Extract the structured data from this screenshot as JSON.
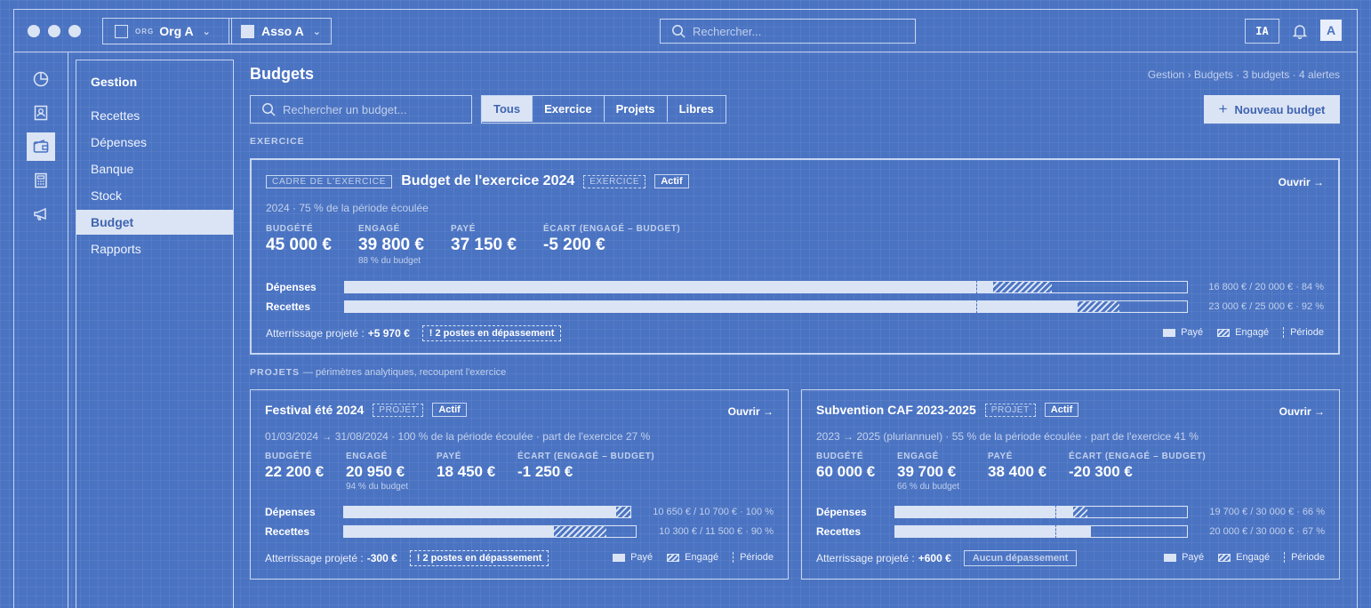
{
  "topbar": {
    "org_tag": "ORG",
    "org_name": "Org A",
    "asso_name": "Asso A",
    "search_placeholder": "Rechercher...",
    "ia_label": "IA",
    "avatar_initial": "A"
  },
  "rail": {
    "icons": [
      "pie-chart-icon",
      "contact-card-icon",
      "wallet-icon",
      "calculator-icon",
      "megaphone-icon"
    ],
    "active": "wallet-icon"
  },
  "sidenav": {
    "title": "Gestion",
    "items": [
      "Recettes",
      "Dépenses",
      "Banque",
      "Stock",
      "Budget",
      "Rapports"
    ],
    "active": "Budget"
  },
  "main": {
    "title": "Budgets",
    "breadcrumb": "Gestion › Budgets · 3 budgets · 4 alertes",
    "search_placeholder": "Rechercher un budget...",
    "filters": [
      "Tous",
      "Exercice",
      "Projets",
      "Libres"
    ],
    "active_filter": "Tous",
    "new_button": "Nouveau budget",
    "section_exercice": "EXERCICE",
    "section_projets": "PROJETS",
    "section_projets_sub": "— périmètres analytiques, recoupent l'exercice"
  },
  "legend": {
    "paid": "Payé",
    "engaged": "Engagé",
    "period": "Période"
  },
  "budgets": [
    {
      "frame_tag": "CADRE DE L'EXERCICE",
      "title": "Budget de l'exercice 2024",
      "type_tag": "EXERCICE",
      "status": "Actif",
      "open": "Ouvrir →",
      "subtitle": "2024 · 75 % de la période écoulée",
      "metrics": [
        {
          "label": "BUDGÉTÉ",
          "value": "45 000 €",
          "note": ""
        },
        {
          "label": "ENGAGÉ",
          "value": "39 800 €",
          "note": "88 % du budget"
        },
        {
          "label": "PAYÉ",
          "value": "37 150 €",
          "note": ""
        },
        {
          "label": "ÉCART (ENGAGÉ – BUDGET)",
          "value": "-5 200 €",
          "note": ""
        }
      ],
      "bars": [
        {
          "label": "Dépenses",
          "paid": 0.77,
          "engaged": 0.84,
          "period": 0.75,
          "stat": "16 800 € / 20 000 € · 84 %"
        },
        {
          "label": "Recettes",
          "paid": 0.87,
          "engaged": 0.92,
          "period": 0.75,
          "stat": "23 000 € / 25 000 € · 92 %"
        }
      ],
      "landing_label": "Atterrissage projeté :",
      "landing_value": "+5 970 €",
      "alert": "! 2 postes en dépassement"
    },
    {
      "title": "Festival été 2024",
      "type_tag": "PROJET",
      "status": "Actif",
      "open": "Ouvrir →",
      "subtitle": "01/03/2024 → 31/08/2024 · 100 % de la période écoulée · part de l'exercice 27 %",
      "metrics": [
        {
          "label": "BUDGÉTÉ",
          "value": "22 200 €",
          "note": ""
        },
        {
          "label": "ENGAGÉ",
          "value": "20 950 €",
          "note": "94 % du budget"
        },
        {
          "label": "PAYÉ",
          "value": "18 450 €",
          "note": ""
        },
        {
          "label": "ÉCART (ENGAGÉ – BUDGET)",
          "value": "-1 250 €",
          "note": ""
        }
      ],
      "bars": [
        {
          "label": "Dépenses",
          "paid": 0.95,
          "engaged": 1.0,
          "period": 1.0,
          "stat": "10 650 € / 10 700 € · 100 %"
        },
        {
          "label": "Recettes",
          "paid": 0.72,
          "engaged": 0.9,
          "period": 1.0,
          "stat": "10 300 € / 11 500 € · 90 %"
        }
      ],
      "landing_label": "Atterrissage projeté :",
      "landing_value": "-300 €",
      "alert": "! 2 postes en dépassement"
    },
    {
      "title": "Subvention CAF 2023-2025",
      "type_tag": "PROJET",
      "status": "Actif",
      "open": "Ouvrir →",
      "subtitle": "2023 → 2025 (pluriannuel) · 55 % de la période écoulée · part de l'exercice 41 %",
      "metrics": [
        {
          "label": "BUDGÉTÉ",
          "value": "60 000 €",
          "note": ""
        },
        {
          "label": "ENGAGÉ",
          "value": "39 700 €",
          "note": "66 % du budget"
        },
        {
          "label": "PAYÉ",
          "value": "38 400 €",
          "note": ""
        },
        {
          "label": "ÉCART (ENGAGÉ – BUDGET)",
          "value": "-20 300 €",
          "note": ""
        }
      ],
      "bars": [
        {
          "label": "Dépenses",
          "paid": 0.61,
          "engaged": 0.66,
          "period": 0.55,
          "stat": "19 700 € / 30 000 € · 66 %"
        },
        {
          "label": "Recettes",
          "paid": 0.67,
          "engaged": 0.67,
          "period": 0.55,
          "stat": "20 000 € / 30 000 € · 67 %"
        }
      ],
      "landing_label": "Atterrissage projeté :",
      "landing_value": "+600 €",
      "ok_tag": "Aucun dépassement"
    }
  ]
}
